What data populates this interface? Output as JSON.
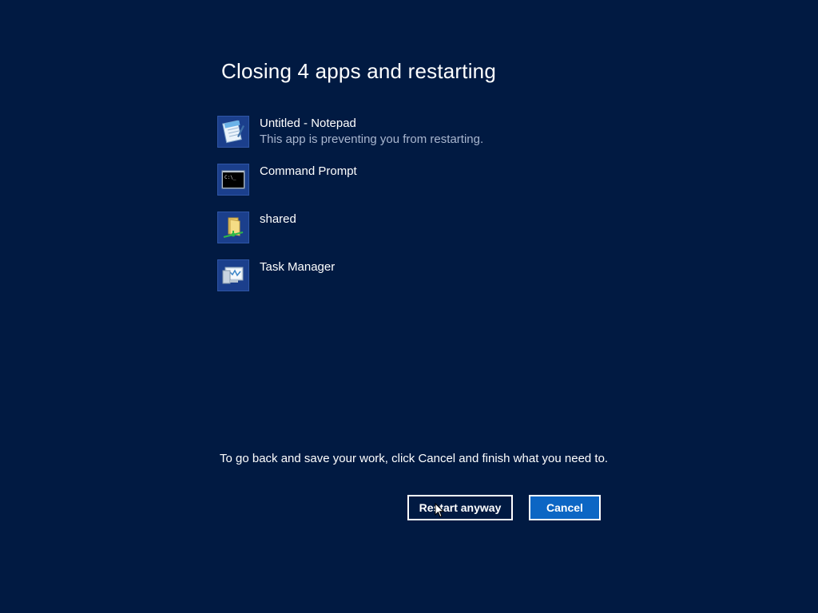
{
  "dialog": {
    "title": "Closing 4 apps and restarting",
    "apps": [
      {
        "name": "Untitled - Notepad",
        "status": "This app is preventing you from restarting.",
        "icon": "notepad-icon"
      },
      {
        "name": "Command Prompt",
        "status": "",
        "icon": "command-prompt-icon",
        "icon_text": "C:\\_"
      },
      {
        "name": "shared",
        "status": "",
        "icon": "shared-folder-icon"
      },
      {
        "name": "Task Manager",
        "status": "",
        "icon": "task-manager-icon"
      }
    ],
    "hint": "To go back and save your work, click Cancel and finish what you need to.",
    "restart_label": "Restart anyway",
    "cancel_label": "Cancel"
  },
  "colors": {
    "background": "#011a42",
    "tile": "#1b3f8c",
    "accent_button": "#0c66c4",
    "subtext": "#a9b6cf"
  }
}
